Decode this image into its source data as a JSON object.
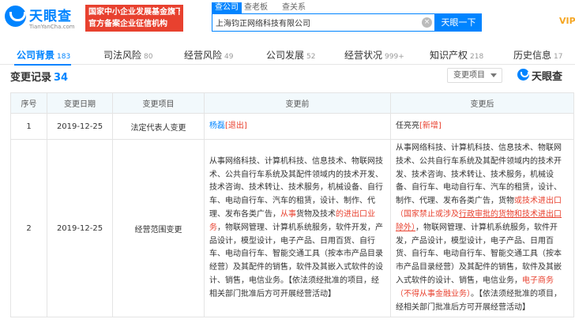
{
  "logo": {
    "name": "天眼查",
    "sub": "TianYanCha.com"
  },
  "banner": {
    "line1": "国家中小企业发展基金旗下",
    "line2": "官方备案企业征信机构"
  },
  "search": {
    "tabs": [
      "查公司",
      "查老板",
      "查关系"
    ],
    "value": "上海钧正网络科技有限公司",
    "clear": "×",
    "button": "天眼一下"
  },
  "vip": "VIP",
  "nav_tabs": [
    {
      "label": "公司背景",
      "count": "183"
    },
    {
      "label": "司法风险",
      "count": "80"
    },
    {
      "label": "经营风险",
      "count": "49"
    },
    {
      "label": "公司发展",
      "count": "52"
    },
    {
      "label": "经营状况",
      "count": "999+"
    },
    {
      "label": "知识产权",
      "count": "218"
    },
    {
      "label": "历史信息",
      "count": "17"
    }
  ],
  "section": {
    "title": "变更记录",
    "count": "34",
    "filter": "变更项目"
  },
  "watermark": "天眼查",
  "table": {
    "headers": [
      "序号",
      "变更日期",
      "变更项目",
      "变更前",
      "变更后"
    ],
    "rows": [
      {
        "no": "1",
        "date": "2019-12-25",
        "item": "法定代表人变更",
        "before": {
          "name": "杨磊",
          "tag": "[退出]"
        },
        "after": {
          "name": "任亮亮",
          "tag": "[新增]"
        }
      },
      {
        "no": "2",
        "date": "2019-12-25",
        "item": "经营范围变更",
        "before": {
          "p1": "从事网络科技、计算机科技、信息技术、物联网技术、公共自行车系统及其配件领域内的技术开发、技术咨询、技术转让、技术服务，机械设备、自行车、电动自行车、汽车的租赁，设计、制作、代理、发布各类广告，",
          "r1": "从事",
          "p2": "货物及技术",
          "r2": "的进出口业务",
          "p3": "，物联网管理、计算机系统服务，软件开发，产品设计，模型设计，电子产品、日用百货、自行车、电动自行车、智能交通工具（按本市产品目录经营）及其配件的销售，软件及其嵌入式软件的设计、销售，电信业务。【依法须经批准的项目，经相关部门批准后方可开展经营活动】"
        },
        "after": {
          "p1": "从事网络科技、计算机科技、信息技术、物联网技术、公共自行车系统及其配件领域内的技术开发、技术咨询、技术转让、技术服务，机械设备、自行车、电动自行车、汽车的租赁，设计、制作、代理、发布各类广告，货物",
          "r1": "或技术进出口（国家禁止或涉及",
          "r2": "行政审批的货物和技术进出口除外）",
          "p2": "，物联网管理、计算机系统服务，软件开发，产品设计，模型设计，电子产品、日用百货、自行车、电动自行车、智能交通工具（按本市产品目录经营）及其配件的销售，软件及其嵌入式软件的设计、销售，电信业务，",
          "r3": "电子商务（不得从事金融业务）",
          "p3": "。【依法须经批准的项目，经相关部门批准后方可开展经营活动】"
        }
      }
    ]
  },
  "colors": {
    "brand": "#0084ff",
    "banner": "#e8412f",
    "header_bg": "#f2f9fc",
    "highlight": "#e8412f"
  }
}
